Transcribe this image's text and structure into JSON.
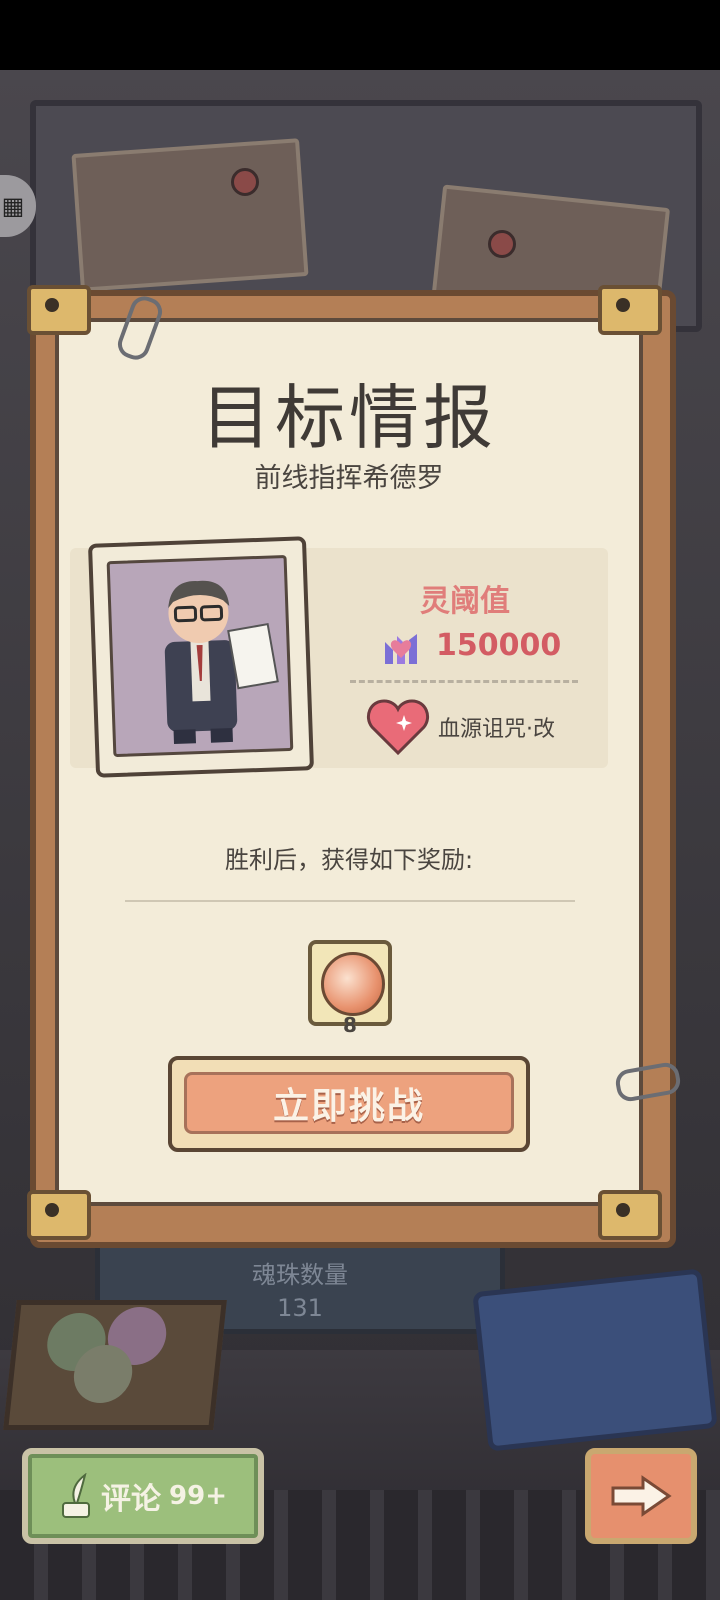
{
  "dialog": {
    "title": "目标情报",
    "subtitle": "前线指挥希德罗",
    "stat_label": "灵阈值",
    "stat_value": "150000",
    "ability_name": "血源诅咒·改",
    "reward_caption": "胜利后，获得如下奖励:",
    "reward_quantity": "8",
    "challenge_label": "立即挑战"
  },
  "background": {
    "soul_label": "魂珠数量",
    "soul_count": "131"
  },
  "bottom_bar": {
    "comment_label": "评论",
    "comment_badge": "99+"
  },
  "icons": {
    "menu": "map-menu-icon",
    "stat": "soul-stat-icon",
    "ability": "heart-gem-icon",
    "reward": "soul-orb-icon",
    "comment": "quill-icon",
    "next": "arrow-right-icon"
  },
  "colors": {
    "paper": "#f3ecd9",
    "frame": "#b47f56",
    "challenge_button": "#eda27e",
    "stat_value": "#d35c63",
    "comment_button": "#9cbf7c"
  }
}
